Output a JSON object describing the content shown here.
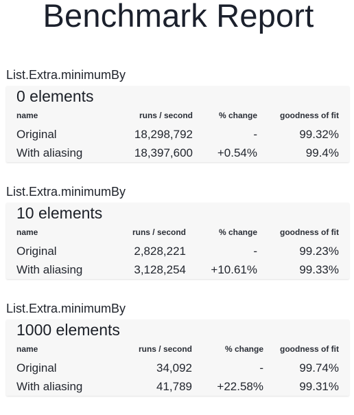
{
  "title": "Benchmark Report",
  "columns": {
    "name": "name",
    "runs": "runs / second",
    "change": "% change",
    "fit": "goodness of fit"
  },
  "groups": [
    {
      "label": "List.Extra.minimumBy",
      "heading": "0 elements",
      "rows": [
        {
          "name": "Original",
          "runs": "18,298,792",
          "change": "-",
          "fit": "99.32%"
        },
        {
          "name": "With aliasing",
          "runs": "18,397,600",
          "change": "+0.54%",
          "fit": "99.4%"
        }
      ]
    },
    {
      "label": "List.Extra.minimumBy",
      "heading": "10 elements",
      "rows": [
        {
          "name": "Original",
          "runs": "2,828,221",
          "change": "-",
          "fit": "99.23%"
        },
        {
          "name": "With aliasing",
          "runs": "3,128,254",
          "change": "+10.61%",
          "fit": "99.33%"
        }
      ]
    },
    {
      "label": "List.Extra.minimumBy",
      "heading": "1000 elements",
      "rows": [
        {
          "name": "Original",
          "runs": "34,092",
          "change": "-",
          "fit": "99.74%"
        },
        {
          "name": "With aliasing",
          "runs": "41,789",
          "change": "+22.58%",
          "fit": "99.31%"
        }
      ]
    }
  ]
}
